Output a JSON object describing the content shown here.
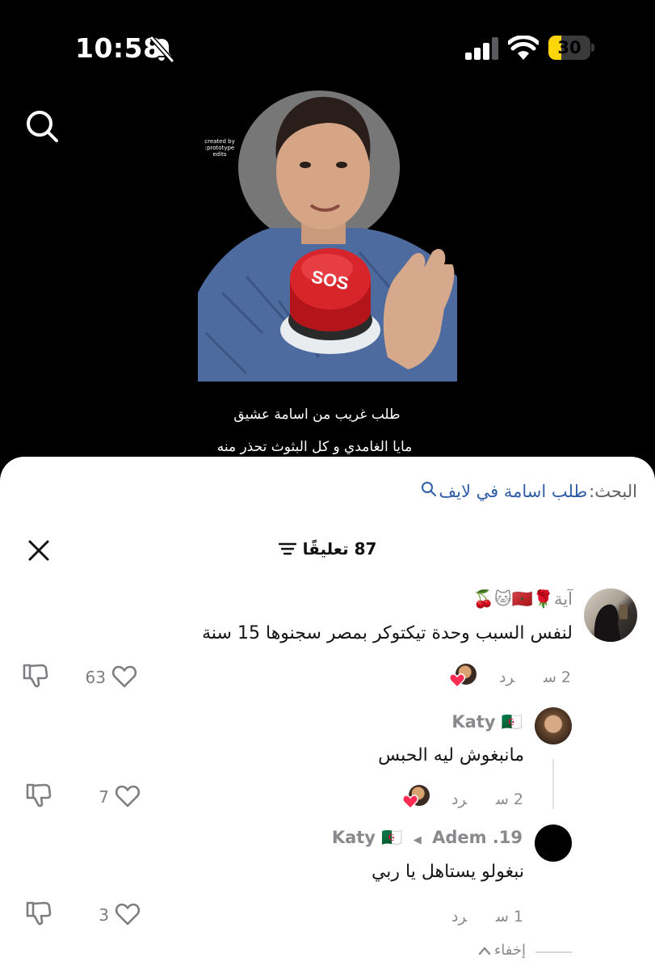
{
  "status_bar": {
    "time": "10:58",
    "battery": "30",
    "battery_level": 0.3,
    "icons": [
      "bell-slash-icon",
      "signal-icon",
      "wifi-icon",
      "battery-icon"
    ]
  },
  "video": {
    "watermark": "created by :prototype\nedits",
    "button_text": "SOS",
    "caption_line1": "طلب غريب من اسامة عشيق",
    "caption_line2": "مايا الغامدي و كل البثوث تحذر منه"
  },
  "comments_sheet": {
    "search_prefix": "البحث:",
    "search_query": "طلب اسامة في لايف",
    "count_label": "87 تعليقًا",
    "comments": [
      {
        "author": "آية🌹🇲🇦🐱🍒",
        "text": "لنفس السبب وحدة تيكتوكر بمصر سجنوها 15 سنة",
        "time": "2 س",
        "reply": "رد",
        "likes": "63"
      },
      {
        "author": "Katy 🇩🇿",
        "text": "مانبغوش ليه الحبس",
        "time": "2 س",
        "reply": "رد",
        "likes": "7"
      },
      {
        "author": "Adem .19",
        "reply_to": "Katy 🇩🇿",
        "text": "نبغولو يستاهل يا ربي",
        "time": "1 س",
        "reply": "رد",
        "likes": "3"
      }
    ],
    "hide_label": "إخفاء"
  },
  "colors": {
    "background": "#000000",
    "sheet": "#ffffff",
    "link_blue": "#2f5da8",
    "muted": "#8a8a8e",
    "battery_yellow": "#ffd60a",
    "like_pink": "#fe2c55"
  }
}
